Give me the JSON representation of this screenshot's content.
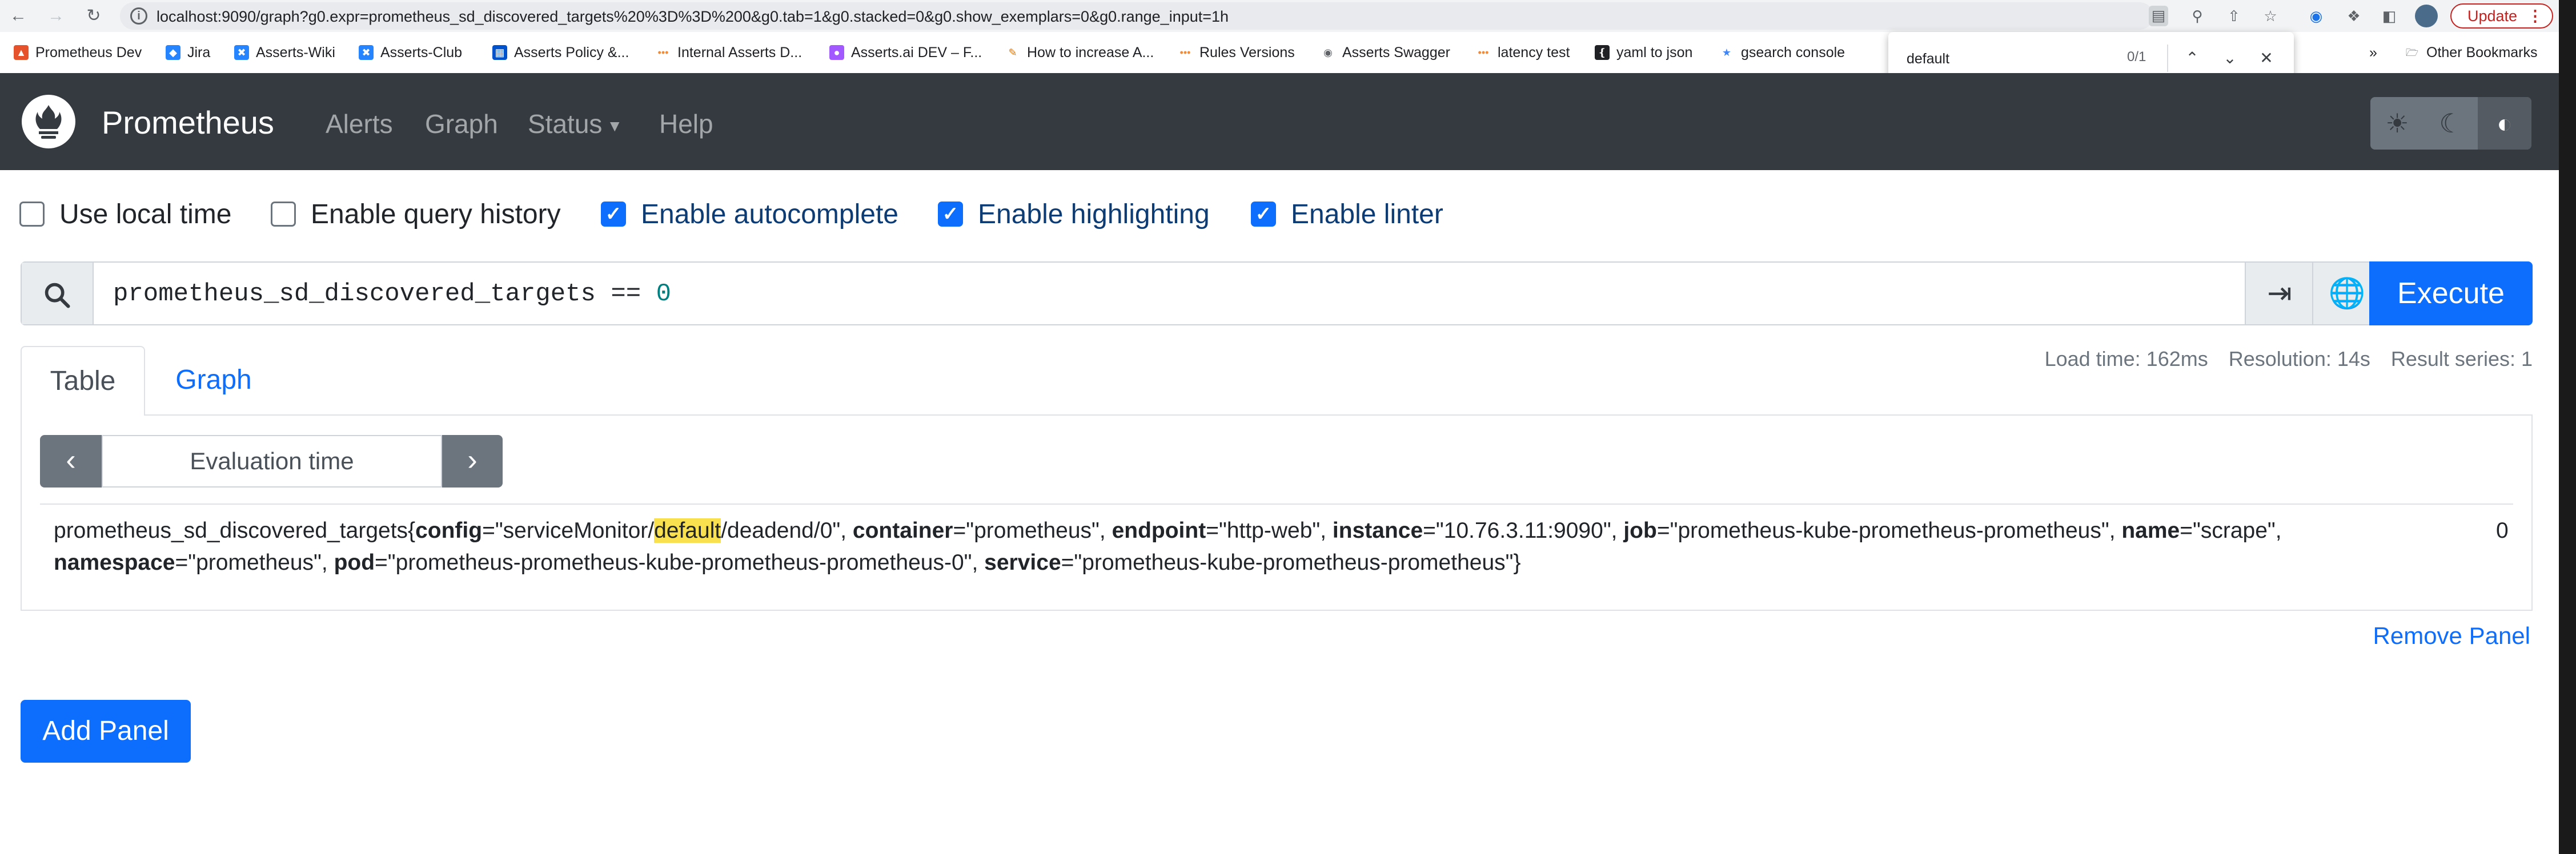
{
  "browser": {
    "url": "localhost:9090/graph?g0.expr=prometheus_sd_discovered_targets%20%3D%3D%200&g0.tab=1&g0.stacked=0&g0.show_exemplars=0&g0.range_input=1h",
    "update_label": "Update",
    "bookmarks": [
      {
        "label": "Prometheus Dev",
        "icon": "flame-icon",
        "color": "#e6522c"
      },
      {
        "label": "Jira",
        "icon": "jira-icon",
        "color": "#2684ff"
      },
      {
        "label": "Asserts-Wiki",
        "icon": "confluence-icon",
        "color": "#2684ff"
      },
      {
        "label": "Asserts-Club",
        "icon": "confluence-icon",
        "color": "#2684ff"
      },
      {
        "label": "Asserts Policy &...",
        "icon": "trello-icon",
        "color": "#0052cc"
      },
      {
        "label": "Internal Asserts D...",
        "icon": "dots-icon",
        "color": "#f28b38"
      },
      {
        "label": "Asserts.ai DEV – F...",
        "icon": "figma-icon",
        "color": "#a259ff"
      },
      {
        "label": "How to increase A...",
        "icon": "pen-icon",
        "color": "#e37400"
      },
      {
        "label": "Rules Versions",
        "icon": "dots-icon",
        "color": "#f28b38"
      },
      {
        "label": "Asserts Swagger",
        "icon": "globe-icon",
        "color": "#5f6368"
      },
      {
        "label": "latency test",
        "icon": "dots-icon",
        "color": "#f28b38"
      },
      {
        "label": "yaml to json",
        "icon": "yaml-icon",
        "color": "#202124"
      },
      {
        "label": "gsearch console",
        "icon": "gsearch-icon",
        "color": "#4285f4"
      }
    ],
    "other_bookmarks": "Other Bookmarks",
    "find": {
      "query": "default",
      "count": "0/1"
    }
  },
  "nav": {
    "brand": "Prometheus",
    "links": [
      "Alerts",
      "Graph",
      "Status",
      "Help"
    ]
  },
  "options": [
    {
      "label": "Use local time",
      "checked": false
    },
    {
      "label": "Enable query history",
      "checked": false
    },
    {
      "label": "Enable autocomplete",
      "checked": true
    },
    {
      "label": "Enable highlighting",
      "checked": true
    },
    {
      "label": "Enable linter",
      "checked": true
    }
  ],
  "expression": {
    "metric": "prometheus_sd_discovered_targets",
    "operator": "==",
    "number": "0"
  },
  "execute_label": "Execute",
  "stats": {
    "load_time": "Load time: 162ms",
    "resolution": "Resolution: 14s",
    "result_series": "Result series: 1"
  },
  "tabs": {
    "table": "Table",
    "graph": "Graph"
  },
  "eval_time_placeholder": "Evaluation time",
  "result": {
    "metric": "prometheus_sd_discovered_targets",
    "labels_line1": [
      {
        "k": "config",
        "pre": "serviceMonitor/",
        "hl": "default",
        "post": "/deadend/0"
      },
      {
        "k": "container",
        "v": "prometheus"
      },
      {
        "k": "endpoint",
        "v": "http-web"
      },
      {
        "k": "instance",
        "v": "10.76.3.11:9090"
      },
      {
        "k": "job",
        "v": "prometheus-kube-prometheus-prometheus"
      },
      {
        "k": "name",
        "v": "scrape"
      }
    ],
    "labels_line2": [
      {
        "k": "namespace",
        "v": "prometheus"
      },
      {
        "k": "pod",
        "v": "prometheus-prometheus-kube-prometheus-prometheus-0"
      },
      {
        "k": "service",
        "v": "prometheus-kube-prometheus-prometheus"
      }
    ],
    "value": "0"
  },
  "remove_panel": "Remove Panel",
  "add_panel": "Add Panel"
}
